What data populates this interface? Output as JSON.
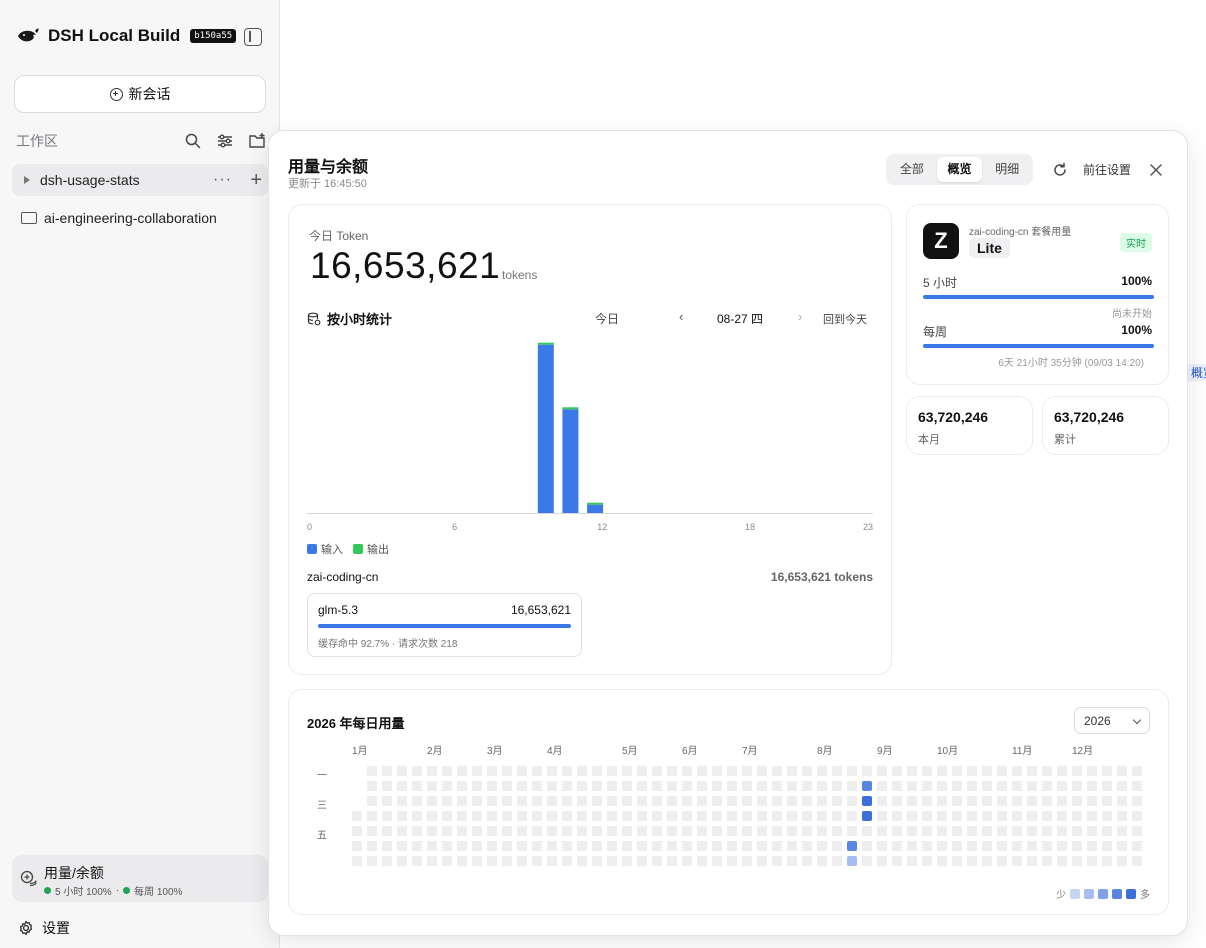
{
  "sidebar": {
    "app_name": "DSH Local Build",
    "build_tag": "b150a55",
    "new_chat_label": "新会话",
    "workspace_label": "工作区",
    "items": [
      {
        "label": "dsh-usage-stats"
      },
      {
        "label": "ai-engineering-collaboration"
      }
    ],
    "usage": {
      "title": "用量/余额",
      "five_hour": "5 小时 100%",
      "weekly": "每周 100%",
      "separator": "·"
    },
    "settings_label": "设置"
  },
  "ghost_tab_label": "概览",
  "modal": {
    "title": "用量与余额",
    "updated": "更新于 16:45:50",
    "tabs": [
      {
        "label": "全部",
        "active": false
      },
      {
        "label": "概览",
        "active": true
      },
      {
        "label": "明细",
        "active": false
      }
    ],
    "goto_settings": "前往设置",
    "today": {
      "label": "今日 Token",
      "value": "16,653,621",
      "unit": "tokens"
    },
    "hourly": {
      "title": "按小时统计",
      "range": "今日",
      "date": "08-27 四",
      "back_today": "回到今天",
      "prev": "‹",
      "next": "›"
    },
    "legend": {
      "input": "输入",
      "output": "输出"
    },
    "provider": {
      "name": "zai-coding-cn",
      "total": "16,653,621 tokens",
      "models": [
        {
          "name": "glm-5.3",
          "value": "16,653,621",
          "share": 1.0,
          "meta": "缓存命中 92.7% · 请求次数 218"
        }
      ]
    },
    "plan": {
      "logo_letter": "Z",
      "name": "zai-coding-cn 套餐用量",
      "tier": "Lite",
      "badge": "实时",
      "quotas": [
        {
          "label": "5 小时",
          "pct": "100%",
          "fill": 1.0,
          "note": "尚未开始"
        },
        {
          "label": "每周",
          "pct": "100%",
          "fill": 1.0,
          "note": "6天 21小时 35分钟 (09/03 14:20)"
        }
      ]
    },
    "stats": [
      {
        "value": "63,720,246",
        "label": "本月"
      },
      {
        "value": "63,720,246",
        "label": "累计"
      }
    ],
    "heatmap": {
      "title": "2026 年每日用量",
      "year": "2026",
      "months": [
        "1月",
        "2月",
        "3月",
        "4月",
        "5月",
        "6月",
        "7月",
        "8月",
        "9月",
        "10月",
        "11月",
        "12月"
      ],
      "weekday_labels": [
        "一",
        "三",
        "五"
      ],
      "legend_less": "少",
      "legend_more": "多",
      "levels": [
        "#eeeef0",
        "#c7d5f5",
        "#a5bdf0",
        "#7ea1ea",
        "#5a86e3",
        "#3b6fdb"
      ],
      "active_days": [
        {
          "week": 33,
          "day": 5,
          "level": 4
        },
        {
          "week": 33,
          "day": 6,
          "level": 2
        },
        {
          "week": 34,
          "day": 1,
          "level": 4
        },
        {
          "week": 34,
          "day": 2,
          "level": 5
        },
        {
          "week": 34,
          "day": 3,
          "level": 5
        }
      ]
    }
  },
  "chart_data": {
    "type": "bar",
    "title": "按小时统计",
    "x_ticks": [
      "0",
      "6",
      "12",
      "18",
      "23"
    ],
    "categories": [
      "0",
      "1",
      "2",
      "3",
      "4",
      "5",
      "6",
      "7",
      "8",
      "9",
      "10",
      "11",
      "12",
      "13",
      "14",
      "15",
      "16",
      "17",
      "18",
      "19",
      "20",
      "21",
      "22",
      "23"
    ],
    "series": [
      {
        "name": "输入",
        "color": "#3b7ae6",
        "values": [
          0,
          0,
          0,
          0,
          0,
          0,
          0,
          0,
          0,
          9900000,
          6100000,
          490000,
          0,
          0,
          0,
          0,
          0,
          0,
          0,
          0,
          0,
          0,
          0,
          0
        ]
      },
      {
        "name": "输出",
        "color": "#34c759",
        "values": [
          0,
          0,
          0,
          0,
          0,
          0,
          0,
          0,
          0,
          90000,
          60000,
          13000,
          0,
          0,
          0,
          0,
          0,
          0,
          0,
          0,
          0,
          0,
          0,
          0
        ]
      }
    ],
    "ylim": [
      0,
      10000000
    ]
  }
}
